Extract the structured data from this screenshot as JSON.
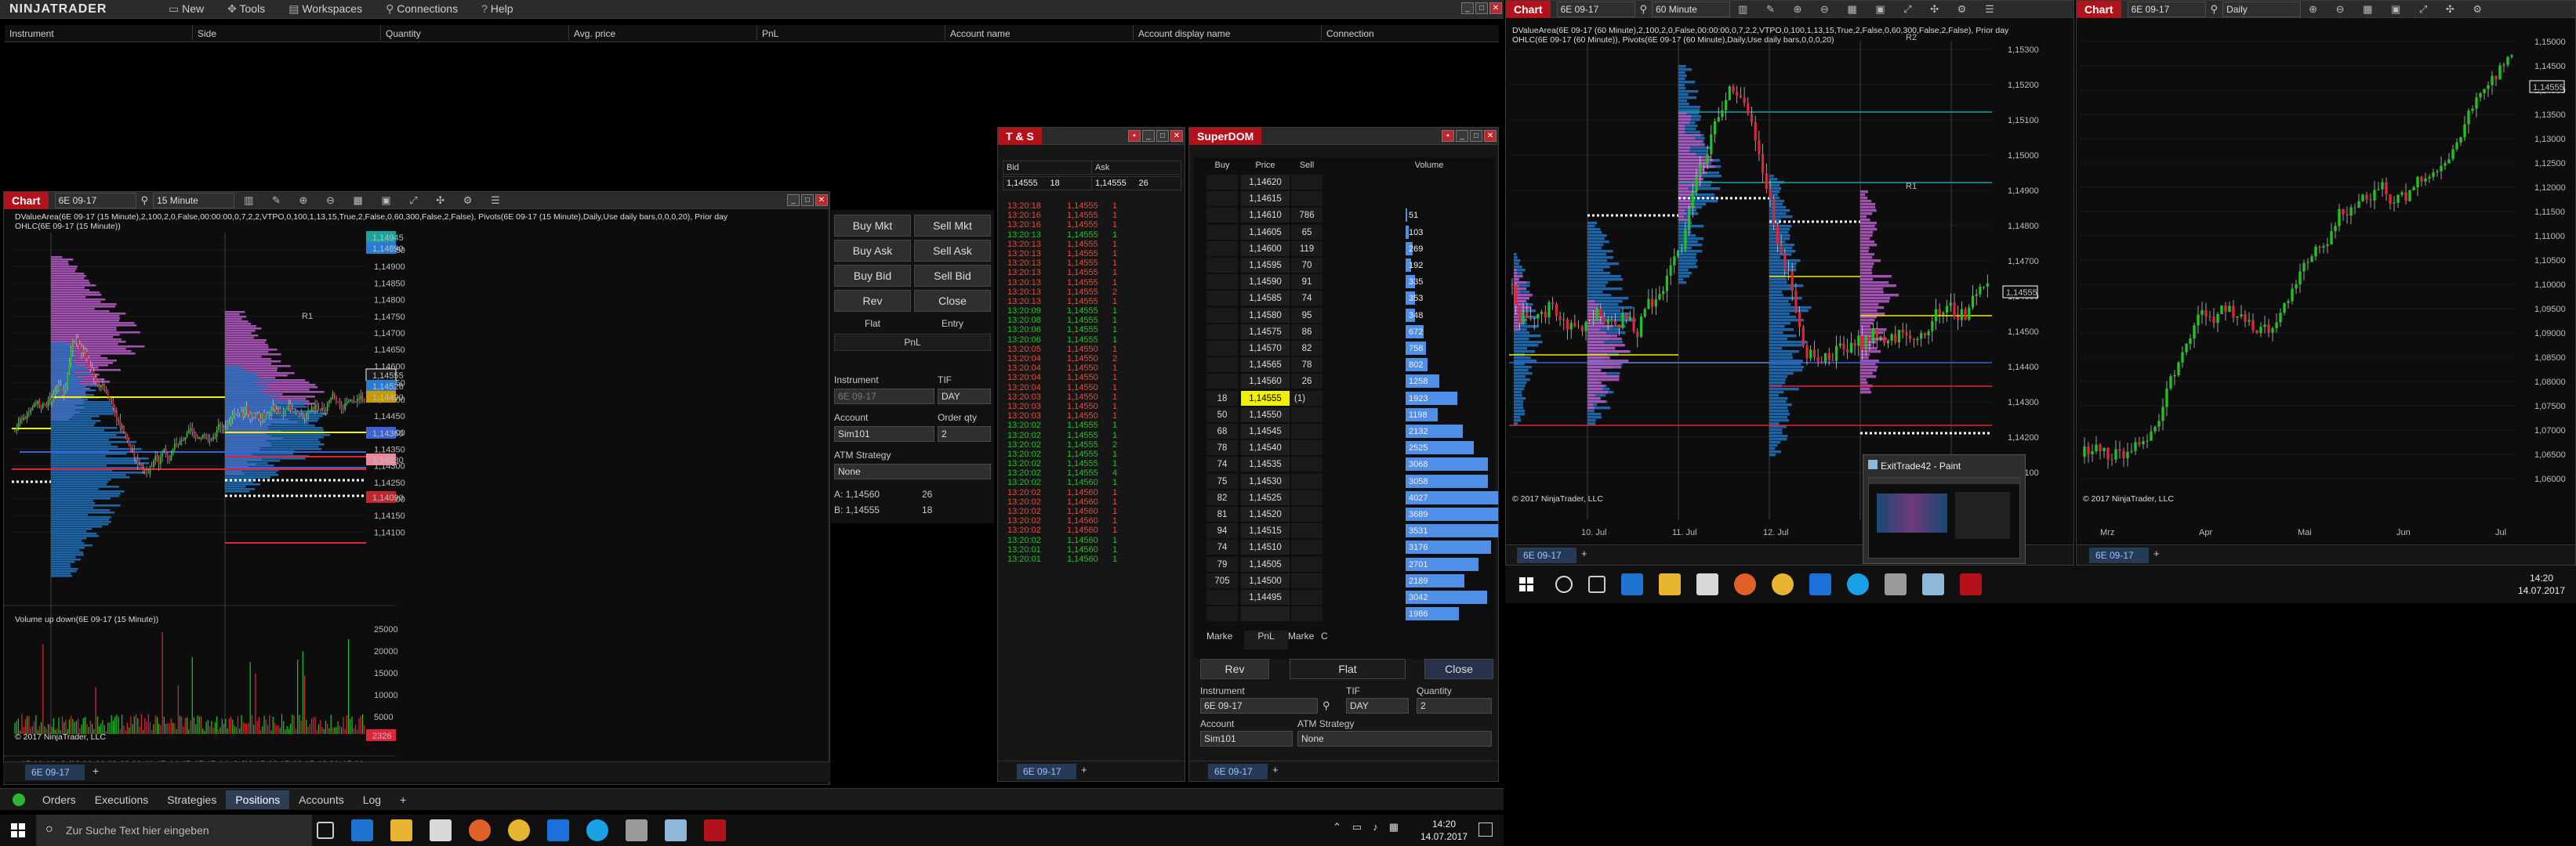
{
  "control_center": {
    "logo": "NINJATRADER",
    "menu": [
      "New",
      "Tools",
      "Workspaces",
      "Connections",
      "Help"
    ],
    "positions_headers": [
      "Instrument",
      "Side",
      "Quantity",
      "Avg. price",
      "PnL",
      "Account name",
      "Account display name",
      "Connection"
    ],
    "bottom_tabs": [
      "Orders",
      "Executions",
      "Strategies",
      "Positions",
      "Accounts",
      "Log"
    ],
    "active_tab": "Positions"
  },
  "chart1": {
    "title": "Chart",
    "instrument": "6E 09-17",
    "interval": "15 Minute",
    "indicator_line1": "DValueArea(6E 09-17 (15 Minute),2,100,2,0,False,00:00:00,0,7,2,2,VTPO,0,100,1,13,15,True,2,False,0,60,300,False,2,False), Pivots(6E 09-17 (15 Minute),Daily,Use daily bars,0,0,0,20), Prior day",
    "indicator_line2": "OHLC(6E 09-17 (15 Minute))",
    "volume_label": "Volume up down(6E 09-17 (15 Minute))",
    "copyright": "© 2017 NinjaTrader, LLC",
    "price_ticks": [
      "1,14950",
      "1,14900",
      "1,14850",
      "1,14800",
      "1,14750",
      "1,14700",
      "1,14650",
      "1,14600",
      "1,14550",
      "1,14500",
      "1,14450",
      "1,14400",
      "1,14350",
      "1,14300",
      "1,14250",
      "1,14200",
      "1,14150",
      "1,14100"
    ],
    "price_tags": [
      {
        "text": "1,14945",
        "color": "#1aa39a"
      },
      {
        "text": "1,14890",
        "color": "#2a7bd4"
      },
      {
        "text": "1,14555",
        "color": "#1a1a1a"
      },
      {
        "text": "1,14526",
        "color": "#2a7bd4"
      },
      {
        "text": "1,14490",
        "color": "#c99a00"
      },
      {
        "text": "1,14360",
        "color": "#3b62d6"
      },
      {
        "text": "1,14230",
        "color": "#e88a9a"
      },
      {
        "text": "1,14090",
        "color": "#c0262e"
      }
    ],
    "vol_ticks": [
      "25000",
      "20000",
      "15000",
      "10000",
      "5000"
    ],
    "vol_tag": "2326",
    "time_ticks": [
      "17:00",
      "13. Jul",
      "03:00",
      "06:00",
      "09:00",
      "11:45",
      "14:45",
      "17:45",
      "14. Jul",
      "03:15",
      "06:15",
      "09:15",
      "12:00",
      "15:00"
    ],
    "r1_label": "R1",
    "tab": "6E 09-17",
    "order_panel": {
      "buy_mkt": "Buy Mkt",
      "sell_mkt": "Sell Mkt",
      "buy_ask": "Buy Ask",
      "sell_ask": "Sell Ask",
      "buy_bid": "Buy Bid",
      "sell_bid": "Sell Bid",
      "rev": "Rev",
      "close": "Close",
      "flat": "Flat",
      "entry": "Entry",
      "pnl": "PnL",
      "instrument_label": "Instrument",
      "instrument": "6E 09-17",
      "tif_label": "TIF",
      "tif": "DAY",
      "account_label": "Account",
      "account": "Sim101",
      "qty_label": "Order qty",
      "qty": "2",
      "atm_label": "ATM Strategy",
      "atm": "None",
      "ask_line": "A: 1,14560",
      "ask_size": "26",
      "bid_line": "B: 1,14555",
      "bid_size": "18"
    }
  },
  "ts": {
    "title": "T & S",
    "bid_label": "Bid",
    "ask_label": "Ask",
    "bid_price": "1,14555",
    "bid_size": "18",
    "ask_price": "1,14555",
    "ask_size": "26",
    "tab": "6E 09-17",
    "rows": [
      [
        "13:20:18",
        "1,14555",
        "1",
        "r"
      ],
      [
        "13:20:16",
        "1,14555",
        "1",
        "r"
      ],
      [
        "13:20:16",
        "1,14555",
        "1",
        "r"
      ],
      [
        "13:20:13",
        "1,14555",
        "1",
        "g"
      ],
      [
        "13:20:13",
        "1,14555",
        "1",
        "r"
      ],
      [
        "13:20:13",
        "1,14555",
        "1",
        "r"
      ],
      [
        "13:20:13",
        "1,14555",
        "1",
        "r"
      ],
      [
        "13:20:13",
        "1,14555",
        "1",
        "r"
      ],
      [
        "13:20:13",
        "1,14555",
        "1",
        "r"
      ],
      [
        "13:20:13",
        "1,14555",
        "2",
        "r"
      ],
      [
        "13:20:13",
        "1,14555",
        "1",
        "r"
      ],
      [
        "13:20:09",
        "1,14555",
        "1",
        "g"
      ],
      [
        "13:20:08",
        "1,14555",
        "1",
        "g"
      ],
      [
        "13:20:06",
        "1,14555",
        "1",
        "g"
      ],
      [
        "13:20:06",
        "1,14555",
        "1",
        "g"
      ],
      [
        "13:20:05",
        "1,14550",
        "1",
        "r"
      ],
      [
        "13:20:04",
        "1,14550",
        "2",
        "r"
      ],
      [
        "13:20:04",
        "1,14550",
        "1",
        "r"
      ],
      [
        "13:20:04",
        "1,14550",
        "1",
        "r"
      ],
      [
        "13:20:04",
        "1,14550",
        "1",
        "r"
      ],
      [
        "13:20:03",
        "1,14550",
        "1",
        "r"
      ],
      [
        "13:20:03",
        "1,14550",
        "1",
        "r"
      ],
      [
        "13:20:03",
        "1,14550",
        "1",
        "r"
      ],
      [
        "13:20:02",
        "1,14555",
        "1",
        "g"
      ],
      [
        "13:20:02",
        "1,14555",
        "1",
        "g"
      ],
      [
        "13:20:02",
        "1,14555",
        "2",
        "g"
      ],
      [
        "13:20:02",
        "1,14555",
        "1",
        "g"
      ],
      [
        "13:20:02",
        "1,14555",
        "1",
        "g"
      ],
      [
        "13:20:02",
        "1,14555",
        "4",
        "g"
      ],
      [
        "13:20:02",
        "1,14560",
        "1",
        "g"
      ],
      [
        "13:20:02",
        "1,14560",
        "1",
        "r"
      ],
      [
        "13:20:02",
        "1,14560",
        "1",
        "r"
      ],
      [
        "13:20:02",
        "1,14560",
        "1",
        "r"
      ],
      [
        "13:20:02",
        "1,14560",
        "1",
        "r"
      ],
      [
        "13:20:02",
        "1,14560",
        "1",
        "r"
      ],
      [
        "13:20:02",
        "1,14560",
        "1",
        "g"
      ],
      [
        "13:20:01",
        "1,14560",
        "1",
        "g"
      ],
      [
        "13:20:01",
        "1,14560",
        "1",
        "g"
      ]
    ]
  },
  "superdom": {
    "title": "SuperDOM",
    "headers": [
      "Buy",
      "Price",
      "Sell",
      "Volume"
    ],
    "rows": [
      [
        "",
        "1,14620",
        "",
        "",
        0
      ],
      [
        "",
        "1,14615",
        "",
        "",
        0
      ],
      [
        "",
        "1,14610",
        "786",
        "51",
        2
      ],
      [
        "",
        "1,14605",
        "65",
        "103",
        4
      ],
      [
        "",
        "1,14600",
        "119",
        "269",
        9
      ],
      [
        "",
        "1,14595",
        "70",
        "192",
        7
      ],
      [
        "",
        "1,14590",
        "91",
        "335",
        12
      ],
      [
        "",
        "1,14585",
        "74",
        "353",
        12
      ],
      [
        "",
        "1,14580",
        "95",
        "348",
        12
      ],
      [
        "",
        "1,14575",
        "86",
        "672",
        23
      ],
      [
        "",
        "1,14570",
        "82",
        "758",
        26
      ],
      [
        "",
        "1,14565",
        "78",
        "802",
        28
      ],
      [
        "",
        "1,14560",
        "26",
        "1258",
        43
      ],
      [
        "18",
        "1,14555",
        "",
        "1923",
        66
      ],
      [
        "50",
        "1,14550",
        "",
        "1198",
        41
      ],
      [
        "68",
        "1,14545",
        "",
        "2132",
        73
      ],
      [
        "78",
        "1,14540",
        "",
        "2525",
        87
      ],
      [
        "74",
        "1,14535",
        "",
        "3068",
        105
      ],
      [
        "75",
        "1,14530",
        "",
        "3058",
        105
      ],
      [
        "82",
        "1,14525",
        "",
        "4027",
        138
      ],
      [
        "81",
        "1,14520",
        "",
        "3689",
        127
      ],
      [
        "94",
        "1,14515",
        "",
        "3531",
        121
      ],
      [
        "74",
        "1,14510",
        "",
        "3176",
        109
      ],
      [
        "79",
        "1,14505",
        "",
        "2701",
        93
      ],
      [
        "705",
        "1,14500",
        "",
        "2189",
        75
      ],
      [
        "",
        "1,14495",
        "",
        "3042",
        104
      ],
      [
        "",
        "",
        "",
        "1986",
        68
      ]
    ],
    "current_price": "1,14555",
    "current_size": "(1)",
    "footer_labels": [
      "Marke",
      "PnL",
      "Marke",
      "C"
    ],
    "rev": "Rev",
    "flat": "Flat",
    "close": "Close",
    "instrument_label": "Instrument",
    "instrument": "6E 09-17",
    "tif_label": "TIF",
    "tif": "DAY",
    "qty_label": "Quantity",
    "qty": "2",
    "account_label": "Account",
    "account": "Sim101",
    "atm_label": "ATM Strategy",
    "atm": "None",
    "tab": "6E 09-17"
  },
  "chart2": {
    "title": "Chart",
    "instrument": "6E 09-17",
    "interval": "60 Minute",
    "indicator_line1": "DValueArea(6E 09-17 (60 Minute),2,100,2,0,False,00:00:00,0,7,2,2,VTPO,0,100,1,13,15,True,2,False,0,60,300,False,2,False), Prior day",
    "indicator_line2": "OHLC(6E 09-17 (60 Minute)), Pivots(6E 09-17 (60 Minute),Daily,Use daily bars,0,0,0,20)",
    "copyright": "© 2017 NinjaTrader, LLC",
    "price_ticks": [
      "1,15300",
      "1,15200",
      "1,15100",
      "1,15000",
      "1,14900",
      "1,14800",
      "1,14700",
      "1,14600",
      "1,14500",
      "1,14400",
      "1,14300",
      "1,14200",
      "1,14100"
    ],
    "price_tag": "1,14555",
    "r2_label": "R2",
    "r1_label": "R1",
    "time_ticks": [
      "10. Jul",
      "11. Jul",
      "12. Jul"
    ],
    "tab": "6E 09-17"
  },
  "chart3": {
    "title": "Chart",
    "instrument": "6E 09-17",
    "interval": "Daily",
    "copyright": "© 2017 NinjaTrader, LLC",
    "price_ticks": [
      "1,15000",
      "1,14500",
      "1,14000",
      "1,13500",
      "1,13000",
      "1,12500",
      "1,12000",
      "1,11500",
      "1,11000",
      "1,10500",
      "1,10000",
      "1,09500",
      "1,09000",
      "1,08500",
      "1,08000",
      "1,07500",
      "1,07000",
      "1,06500",
      "1,06000"
    ],
    "price_tag": "1,14555",
    "time_ticks": [
      "Mrz",
      "Apr",
      "Mai",
      "Jun",
      "Jul"
    ],
    "tab": "6E 09-17"
  },
  "paint_thumb": {
    "title": "ExitTrade42 - Paint"
  },
  "taskbar_left": {
    "search_placeholder": "Zur Suche Text hier eingeben",
    "time": "14:20",
    "date": "14.07.2017"
  },
  "taskbar_right": {
    "time": "14:20",
    "date": "14.07.2017"
  },
  "colors": {
    "candle_up": "#1ec51e",
    "candle_down": "#e0253a",
    "profile_blue": "#1f6fb8",
    "profile_magenta": "#b058c0",
    "poc_yellow": "#f2f200",
    "pivot_red": "#e0253a"
  }
}
